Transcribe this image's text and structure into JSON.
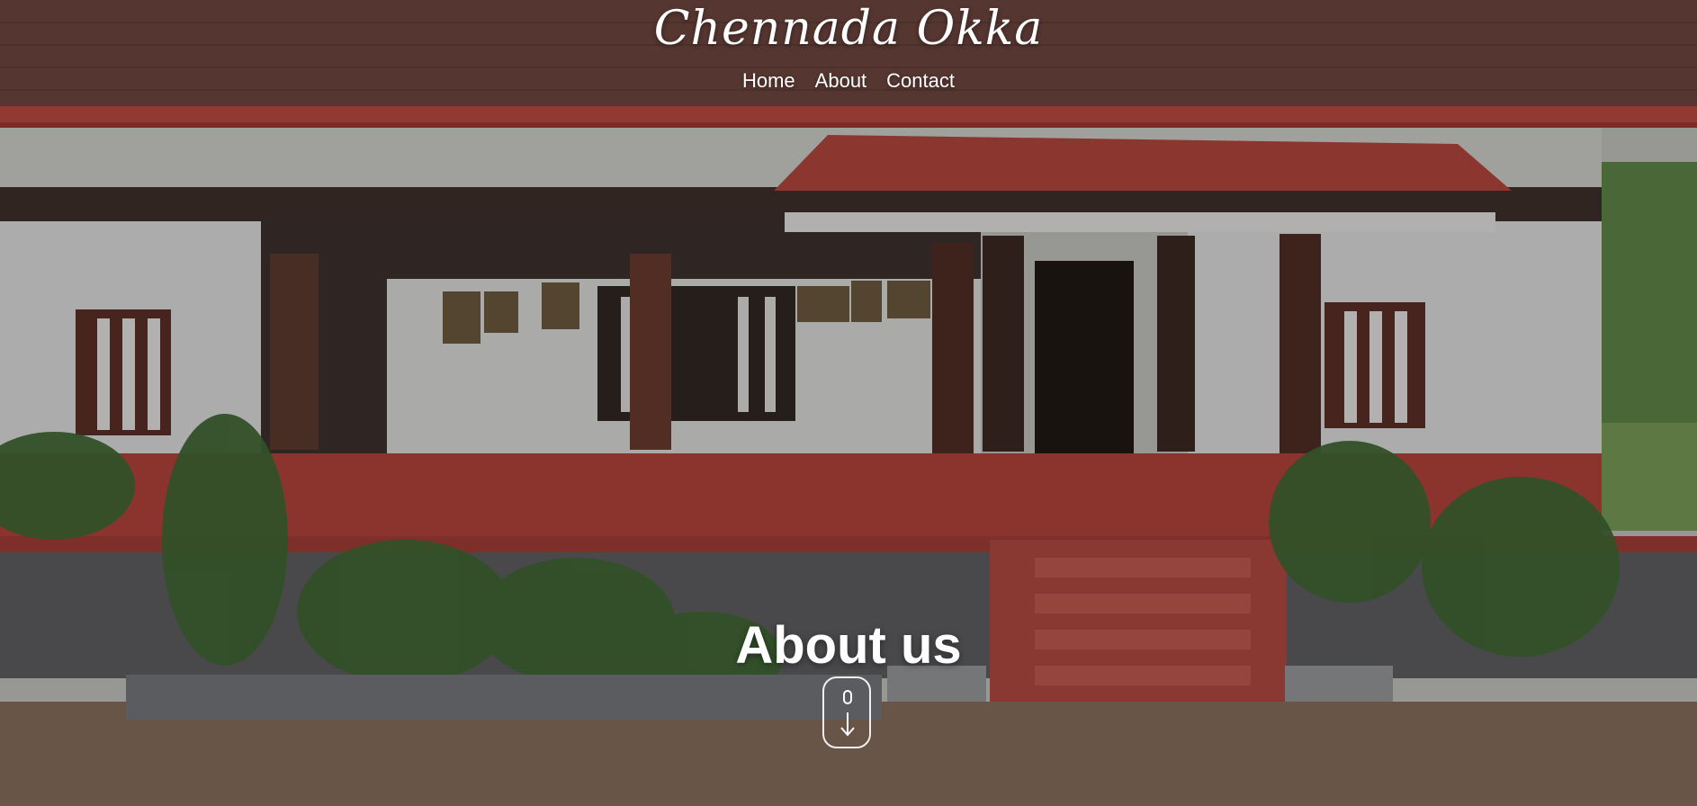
{
  "site": {
    "title": "Chennada Okka"
  },
  "nav": {
    "items": [
      {
        "label": "Home"
      },
      {
        "label": "About"
      },
      {
        "label": "Contact"
      }
    ]
  },
  "hero": {
    "heading": "About us",
    "scroll_icon": "mouse-scroll-down-icon"
  },
  "colors": {
    "roof": "#7b4a42",
    "wall": "#e9ecef",
    "plinth": "#c8463c",
    "text": "#ffffff"
  }
}
